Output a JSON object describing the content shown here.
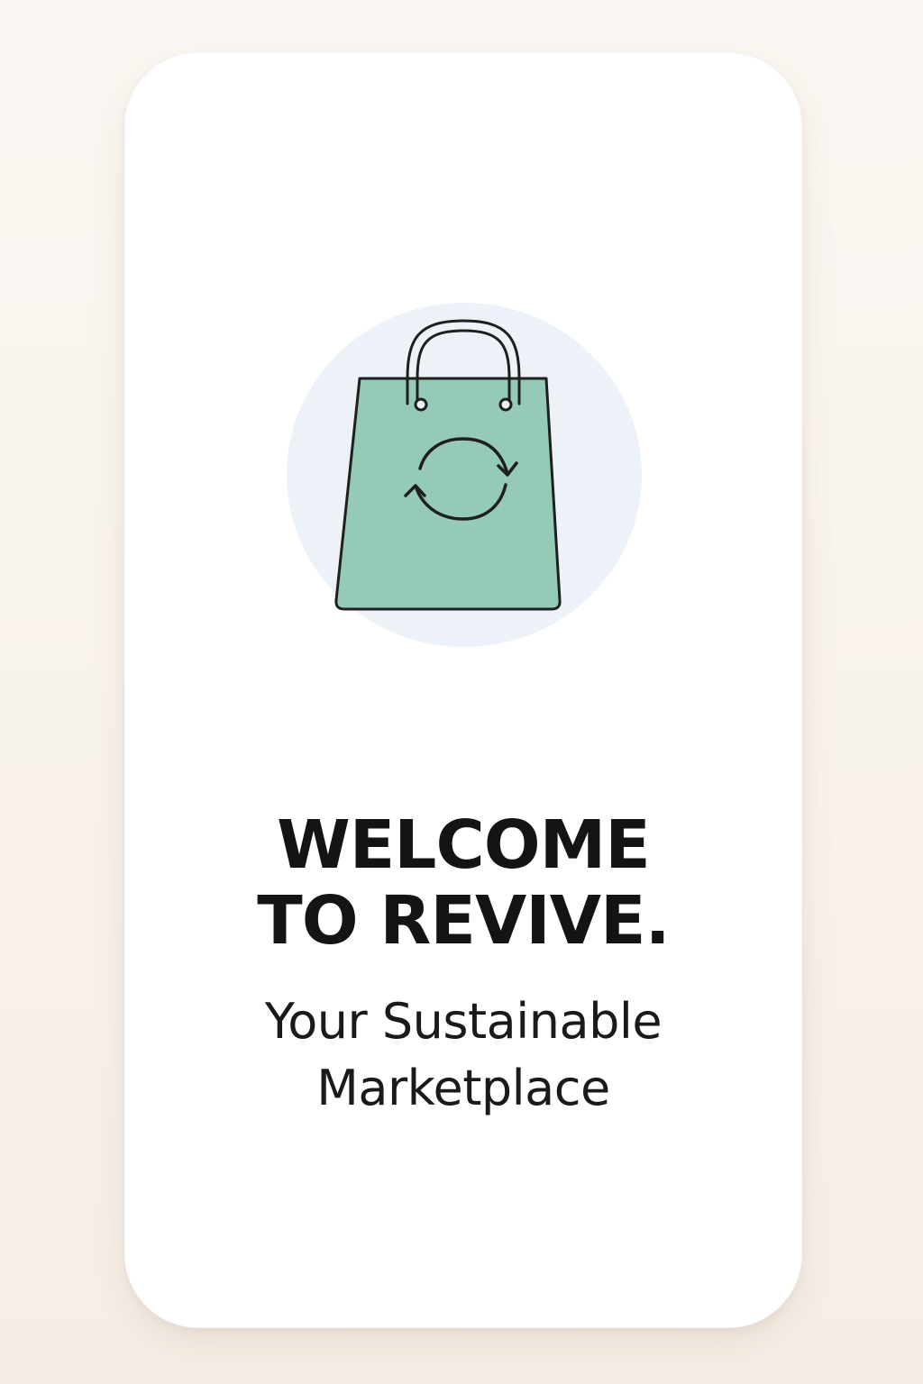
{
  "screen": {
    "background_color": "#ffffff",
    "page_background_color": "#f8f1ea"
  },
  "logo": {
    "icon": "shopping-bag-recycle-icon",
    "circle_color": "#edf2f9",
    "bag_color": "#95c9b8",
    "stroke_color": "#1f1f1f"
  },
  "welcome": {
    "title_line_1": "WELCOME",
    "title_line_2": "TO REVIVE.",
    "subtitle_line_1": "Your Sustainable",
    "subtitle_line_2": "Marketplace"
  }
}
